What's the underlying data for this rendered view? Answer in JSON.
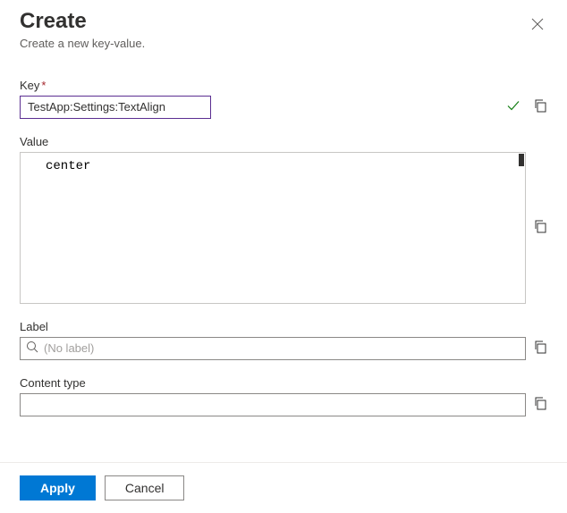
{
  "header": {
    "title": "Create",
    "subtitle": "Create a new key-value."
  },
  "fields": {
    "key": {
      "label": "Key",
      "required_marker": "*",
      "value": "TestApp:Settings:TextAlign"
    },
    "value": {
      "label": "Value",
      "value": "center"
    },
    "labelField": {
      "label": "Label",
      "placeholder": "(No label)",
      "value": ""
    },
    "contentType": {
      "label": "Content type",
      "value": ""
    }
  },
  "footer": {
    "apply": "Apply",
    "cancel": "Cancel"
  }
}
